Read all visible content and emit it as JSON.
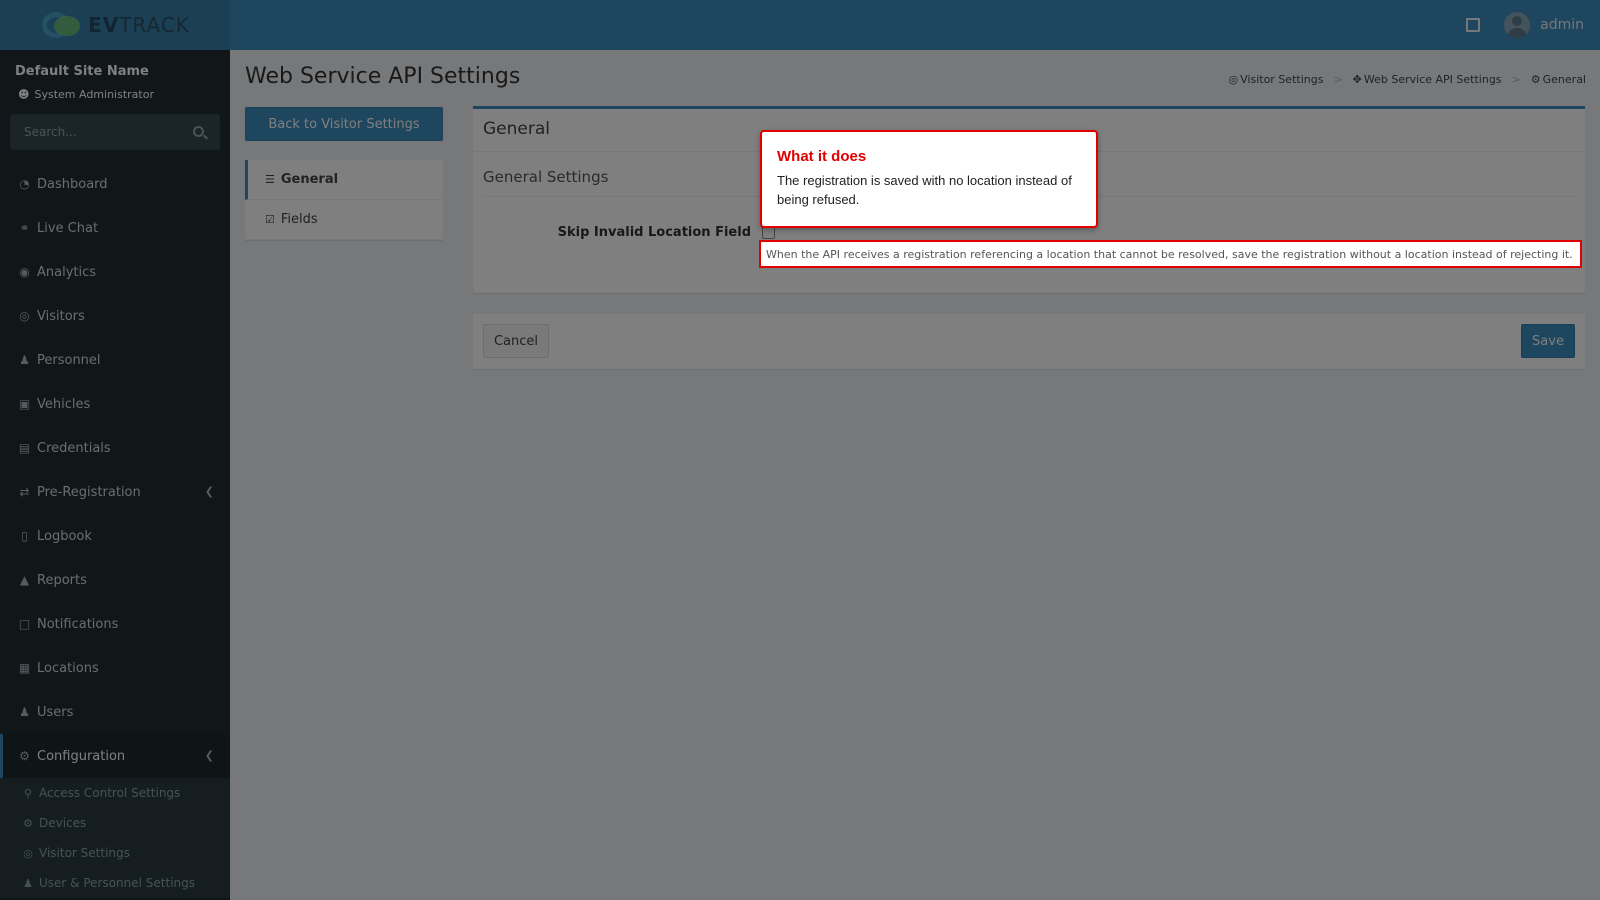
{
  "brand": {
    "name_bold": "EV",
    "name_rest": "TRACK"
  },
  "topbar": {
    "username": "admin"
  },
  "sidebar": {
    "site_name": "Default Site Name",
    "role": "System Administrator",
    "search_placeholder": "Search...",
    "items": [
      {
        "label": "Dashboard",
        "icon": "dashboard-icon"
      },
      {
        "label": "Live Chat",
        "icon": "headset-icon"
      },
      {
        "label": "Analytics",
        "icon": "target-icon"
      },
      {
        "label": "Visitors",
        "icon": "eye-icon"
      },
      {
        "label": "Personnel",
        "icon": "user-tie-icon"
      },
      {
        "label": "Vehicles",
        "icon": "car-icon"
      },
      {
        "label": "Credentials",
        "icon": "id-badge-icon"
      },
      {
        "label": "Pre-Registration",
        "icon": "exchange-icon"
      },
      {
        "label": "Logbook",
        "icon": "book-icon"
      },
      {
        "label": "Reports",
        "icon": "chart-icon"
      },
      {
        "label": "Notifications",
        "icon": "comments-icon"
      },
      {
        "label": "Locations",
        "icon": "map-icon"
      },
      {
        "label": "Users",
        "icon": "user-gear-icon"
      },
      {
        "label": "Configuration",
        "icon": "cog-icon"
      }
    ],
    "sub_items": [
      {
        "label": "Access Control Settings",
        "icon": "lock-icon"
      },
      {
        "label": "Devices",
        "icon": "gear-icon"
      },
      {
        "label": "Visitor Settings",
        "icon": "eye-icon"
      },
      {
        "label": "User & Personnel Settings",
        "icon": "user-gear-icon"
      }
    ]
  },
  "page": {
    "title": "Web Service API Settings",
    "breadcrumb": [
      "Visitor Settings",
      "Web Service API Settings",
      "General"
    ],
    "back_button": "Back to Visitor Settings",
    "tabs": [
      "General",
      "Fields"
    ],
    "panel_title": "General",
    "section_title": "General Settings",
    "field_label": "Skip Invalid Location Field",
    "field_help": "When the API receives a registration referencing a location that cannot be resolved, save the registration without a location instead of rejecting it.",
    "cancel_label": "Cancel",
    "save_label": "Save"
  },
  "callout": {
    "title": "What it does",
    "body": "The registration is saved with no location instead of being refused."
  },
  "colors": {
    "primary": "#3c8dbc",
    "sidebar": "#222d32",
    "highlight": "#e00000"
  }
}
